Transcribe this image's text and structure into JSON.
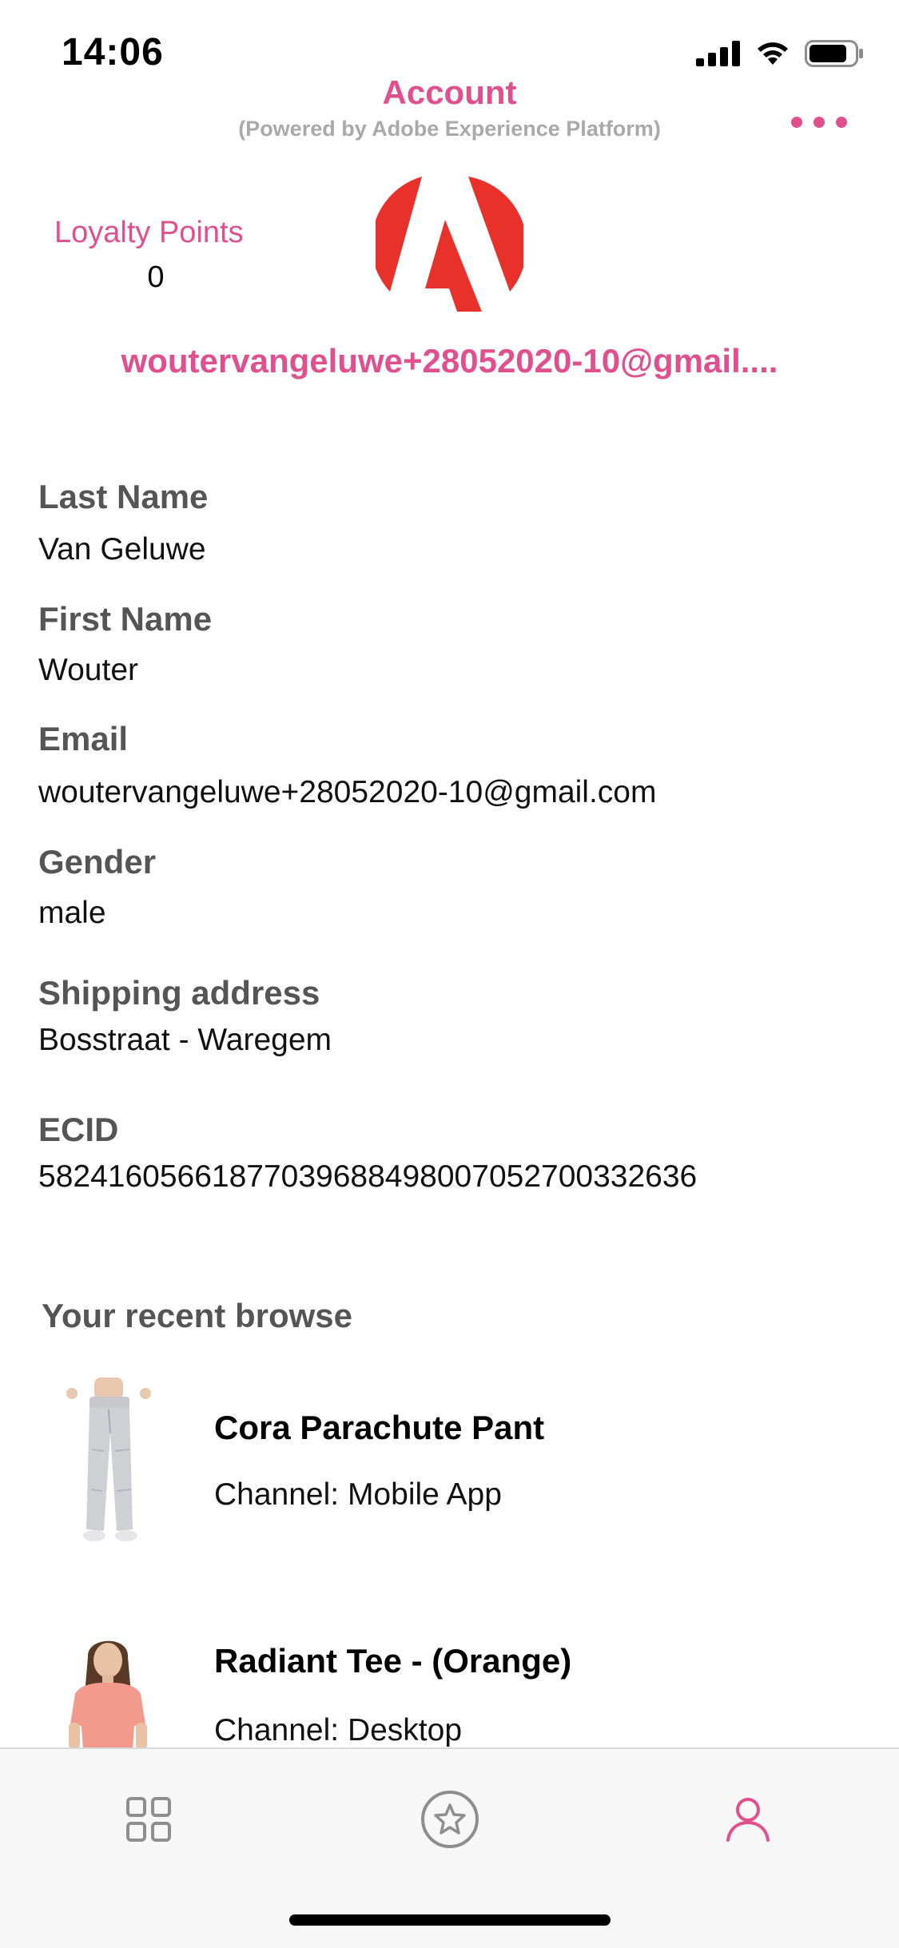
{
  "status_bar": {
    "time": "14:06",
    "icons": [
      "signal-icon",
      "wifi-icon",
      "battery-icon"
    ]
  },
  "header": {
    "title": "Account",
    "subtitle": "(Powered by Adobe Experience Platform)",
    "more_icon": "more-horizontal-icon"
  },
  "loyalty": {
    "label": "Loyalty Points",
    "value": "0"
  },
  "account_email": "woutervangeluwe+28052020-10@gmail....",
  "profile": {
    "last_name": {
      "label": "Last Name",
      "value": "Van Geluwe"
    },
    "first_name": {
      "label": "First Name",
      "value": "Wouter"
    },
    "email": {
      "label": "Email",
      "value": "woutervangeluwe+28052020-10@gmail.com"
    },
    "gender": {
      "label": "Gender",
      "value": "male"
    },
    "shipping_address": {
      "label": "Shipping address",
      "value": "Bosstraat - Waregem"
    },
    "ecid": {
      "label": "ECID",
      "value": "58241605661877039688498007052700332636"
    }
  },
  "recent_browse": {
    "title": "Your recent browse",
    "items": [
      {
        "name": "Cora Parachute Pant",
        "channel": "Channel: Mobile App"
      },
      {
        "name": "Radiant Tee - (Orange)",
        "channel": "Channel: Desktop"
      }
    ]
  },
  "tab_bar": {
    "tabs": [
      {
        "icon": "grid-icon",
        "active": false
      },
      {
        "icon": "star-icon",
        "active": false
      },
      {
        "icon": "user-icon",
        "active": true
      }
    ]
  },
  "colors": {
    "accent": "#e0508f",
    "label_gray": "#555555",
    "subtitle_gray": "#a9a9a9",
    "logo_red": "#e8312a",
    "inactive_icon": "#8e8e8e"
  }
}
